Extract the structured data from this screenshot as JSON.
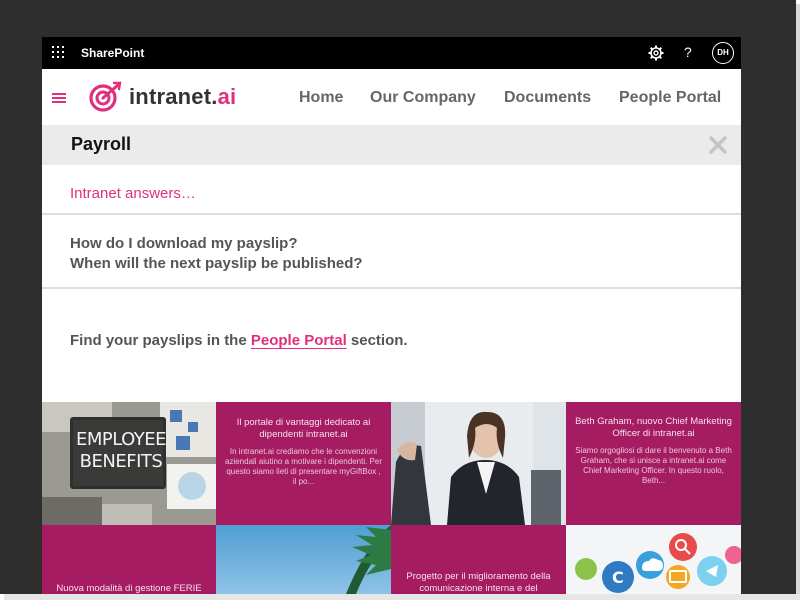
{
  "suite_bar": {
    "app_name": "SharePoint",
    "help_glyph": "?",
    "user_initials": "DH"
  },
  "site_header": {
    "logo_text": "intranet.",
    "logo_text_accent": "ai",
    "nav": [
      "Home",
      "Our Company",
      "Documents",
      "People Portal"
    ]
  },
  "panel": {
    "title": "Payroll",
    "answers_label": "Intranet answers…",
    "questions": [
      "How do I download my payslip?",
      "When will the next payslip be published?"
    ],
    "answer_prefix": "Find your payslips in the",
    "answer_link": "People Portal",
    "answer_suffix": "section."
  },
  "tiles": {
    "employee_benefits": {
      "line1": "EMPLOYEE",
      "line2": "BENEFITS"
    },
    "portale": {
      "title": "Il portale di vantaggi dedicato ai dipendenti intranet.ai",
      "body": "In intranet.ai crediamo che le convenzioni aziendali aiutino a motivare i dipendenti. Per questo siamo lieti di presentare myGiftBox , il po..."
    },
    "beth": {
      "title": "Beth Graham, nuovo Chief Marketing Officer di intranet.ai",
      "body": "Siamo orgogliosi di dare il benvenuto a Beth Graham, che si unisce a intranet.ai come Chief Marketing Officer.  In questo ruolo, Beth..."
    },
    "ferie": {
      "title": "Nuova modalità di gestione FERIE"
    },
    "progetto": {
      "title": "Progetto per il miglioramento della comunicazione interna e del"
    }
  },
  "colors": {
    "brand_pink": "#e0307d",
    "tile_magenta": "#a51c63",
    "suite_bar": "#000000",
    "panel_bar": "#ebebeb"
  },
  "icons": [
    "waffle-icon",
    "gear-icon",
    "help-icon",
    "hamburger-icon",
    "logo-target-icon",
    "close-icon"
  ]
}
